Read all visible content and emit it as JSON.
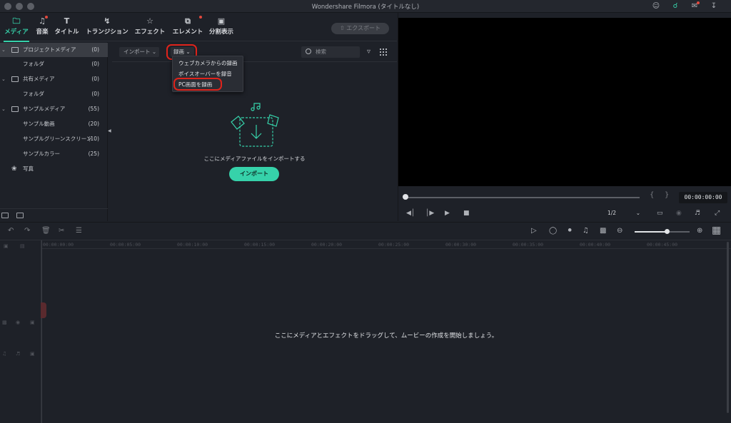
{
  "window": {
    "title": "Wondershare Filmora (タイトルなし)"
  },
  "toolbar": {
    "tabs": [
      {
        "label": "メディア",
        "icon": "folder-icon",
        "active": true
      },
      {
        "label": "音楽",
        "icon": "music-note-icon",
        "badge": true
      },
      {
        "label": "タイトル",
        "icon": "text-t-icon"
      },
      {
        "label": "トランジション",
        "icon": "transition-icon"
      },
      {
        "label": "エフェクト",
        "icon": "effects-star-icon"
      },
      {
        "label": "エレメント",
        "icon": "elements-icon",
        "badge": true
      },
      {
        "label": "分割表示",
        "icon": "split-screen-icon"
      }
    ],
    "export_label": "エクスポート"
  },
  "tree": {
    "items": [
      {
        "label": "プロジェクトメディア",
        "count": "(0)"
      },
      {
        "label": "フォルダ",
        "count": "(0)"
      },
      {
        "label": "共有メディア",
        "count": "(0)"
      },
      {
        "label": "フォルダ",
        "count": "(0)"
      },
      {
        "label": "サンプルメディア",
        "count": "(55)"
      },
      {
        "label": "サンプル動画",
        "count": "(20)"
      },
      {
        "label": "サンプルグリーンスクリーン",
        "count": "(10)"
      },
      {
        "label": "サンプルカラー",
        "count": "(25)"
      },
      {
        "label": "写真",
        "count": ""
      }
    ]
  },
  "media": {
    "import_label": "インポート",
    "record_label": "録画",
    "search_placeholder": "検索",
    "record_menu": [
      "ウェブカメラからの録画",
      "ボイスオーバーを録音",
      "PC画面を録画"
    ],
    "drop_hint": "ここにメディアファイルをインポートする",
    "import_button": "インポート"
  },
  "preview": {
    "timecode": "00:00:00:00",
    "ratio": "1/2",
    "progress": 0
  },
  "timeline": {
    "ruler": [
      "00:00:00:00",
      "00:00:05:00",
      "00:00:10:00",
      "00:00:15:00",
      "00:00:20:00",
      "00:00:25:00",
      "00:00:30:00",
      "00:00:35:00",
      "00:00:40:00",
      "00:00:45:00"
    ],
    "hint": "ここにメディアとエフェクトをドラッグして、ムービーの作成を開始しましょう。",
    "zoom": 0.6
  },
  "colors": {
    "accent": "#36d2aa",
    "highlight": "#e0231b",
    "badge": "#e2483d"
  }
}
